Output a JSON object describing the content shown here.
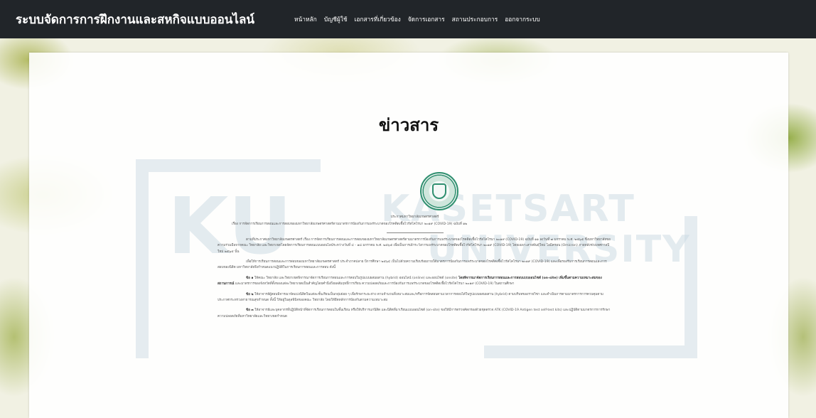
{
  "navbar": {
    "brand": "ระบบจัดการการฝึกงานและสหกิจแบบออนไลน์",
    "links": [
      "หน้าหลัก",
      "บัญชีผู้ใช้",
      "เอกสารที่เกี่ยวข้อง",
      "จัดการเอกสาร",
      "สถานประกอบการ",
      "ออกจากระบบ"
    ]
  },
  "watermark": {
    "ku": "KU",
    "kasetsart": "KASETSART",
    "university": "UNIVERSITY"
  },
  "page": {
    "title": "ข่าวสาร"
  },
  "announcement": {
    "heading": "ประกาศมหาวิทยาลัยเกษตรศาสตร์",
    "subject": "เรื่อง  การจัดการเรียนการสอนและการสอบของมหาวิทยาลัยเกษตรศาสตร์ตามมาตรการป้องกันการแพร่ระบาดของโรคติดเชื้อไวรัสโคโรนา ๒๐๑๙ (COVID-19) ฉบับที่ ๑๒",
    "paragraphs": [
      "ตามที่ประกาศมหาวิทยาลัยเกษตรศาสตร์ เรื่อง การจัดการเรียนการสอนและการสอบของมหาวิทยาลัยเกษตรศาสตร์ตามมาตรการป้องกันการแพร่ระบาดของโรคติดเชื้อไวรัสโคโรนา ๒๐๑๙ (COVID-19) ฉบับที่ ๑๑ ลงวันที่ ๗ มกราคม พ.ศ. ๒๕๖๕ ซึ่งมหาวิทยาลัยขอความร่วมมือจากคณะ วิทยาลัย และวิทยาเขตโดยจัดการเรียนการสอนแบบออนไลน์ระหว่างวันที่ ๔ - ๑๘ มกราคม พ.ศ. ๒๕๖๕ เพื่อเป็นการเฝ้าระวังการแพร่ระบาดของโรคติดเชื้อไวรัสโคโรนา ๒๐๑๙ (COVID-19) โดยเฉพาะสายพันธุ์ใหม่ โอมิครอน (Omicron) ภายหลังช่วงเทศกาลปีใหม่ ๒๕๖๕ นั้น",
      "เพื่อให้การเรียนการสอนและการสอบของมหาวิทยาลัยเกษตรศาสตร์ ประจำภาคปลาย ปีการศึกษา ๒๕๖๔ เป็นไปด้วยความเรียบร้อยภายใต้มาตรการป้องกันการแพร่ระบาดของโรคติดเชื้อไวรัสโคโรนา ๒๐๑๙ (COVID-19) และเพื่อรองรับการเรียนการสอนและการสอบของนิสิต มหาวิทยาลัยจึงกำหนดแนวปฏิบัติในการเรียนการสอนและการสอบ ดังนี้"
    ],
    "item1_label": "ข้อ ๑",
    "item1_text": "ให้คณะ วิทยาลัย และวิทยาเขตพิจารณาจัดการเรียนการสอนและการสอบในรูปแบบผสมผสาน (hybrid) ออนไลน์ (online) และออนไซต์ (onsite)",
    "item1_bold": "โดยพิจารณาจัดการเรียนการสอนและการสอบแบบออนไซต์ (on-site) เพิ่มขึ้นตามความเหมาะสมของสถานการณ์",
    "item1_rest": "และมาตรการของจังหวัดที่ตั้งของแต่ละวิทยาเขตเป็นสำคัญโดยคำนึงถึงผลสัมฤทธิ์การเรียน ความปลอดภัยและการป้องกันการแพร่ระบาดของโรคติดเชื้อไวรัสโคโรนา ๒๐๑๙ (COVID-19) ในสถานศึกษา",
    "item2_label": "ข้อ ๒",
    "item2_text": "ให้อาจารย์ผู้สอนพิจารณาจัดแบ่งนิสิตในแต่ละชั้นเรียนเป็นกลุ่มย่อย ๆ เพื่อรักษาระยะห่าง ตามจำนวนที่เหมาะสมและ/หรือการจัดสอบตามเวลาการสอบได้ในรูปแบบผสมผสาน (hybrid) ตามบริบทของรายวิชา และดำเนินการตามมาตรการการควบคุมตามประกาศกระทรวงสาธารณสุขกำหนด ทั้งนี้ ให้อยู่ในดุลพินิจของคณะ วิทยาลัย โดยให้ยึดหลักการป้องกันตามความเหมาะสม",
    "item3_label": "ข้อ ๓",
    "item3_text": "ให้อาจารย์และบุคลากรที่ปฏิบัติหน้าที่จัดการเรียนการสอนในชั้นเรียน หรือให้บริการแก่นิสิต และนิสิตที่มาเรียนแบบออนไซต์ (on-site) ขอให้มีการตรวจคัดกรองด้วยชุดตรวจ ATK (COVID-19 Antigen test self-test kits) และปฏิบัติตามมาตรการการรักษาความปลอดภัยที่มหาวิทยาลัยและวิทยาเขตกำหนด"
  }
}
